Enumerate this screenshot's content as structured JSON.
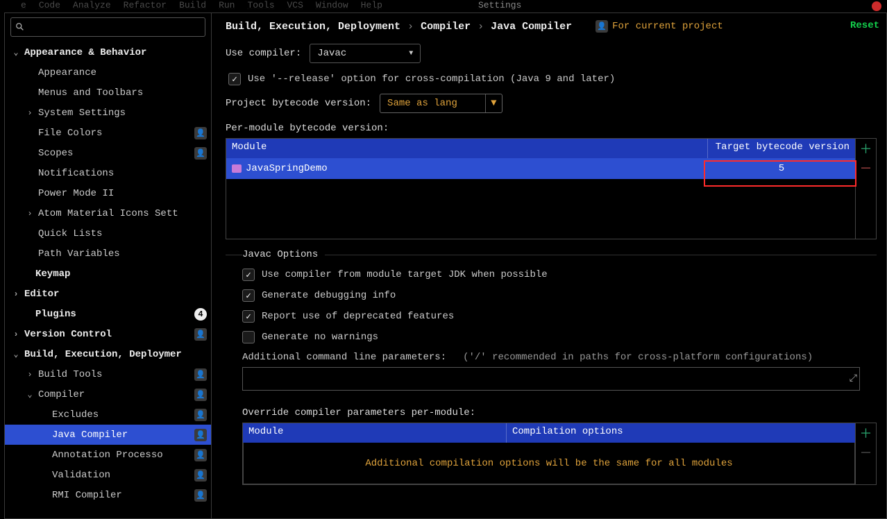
{
  "topmenu": [
    "e",
    "Code",
    "Analyze",
    "Refactor",
    "Build",
    "Run",
    "Tools",
    "VCS",
    "Window",
    "Help"
  ],
  "topmenu_tab": "Settings",
  "breadcrumb": {
    "a": "Build, Execution, Deployment",
    "b": "Compiler",
    "c": "Java Compiler",
    "for_project": "For current project",
    "reset": "Reset"
  },
  "use_compiler": {
    "label": "Use compiler:",
    "value": "Javac"
  },
  "release_option": {
    "label": "Use '--release' option for cross-compilation (Java 9 and later)",
    "checked": true
  },
  "project_bc": {
    "label": "Project bytecode version:",
    "value": "Same as lang"
  },
  "per_module_label": "Per-module bytecode version:",
  "per_module_headers": {
    "module": "Module",
    "target": "Target bytecode version"
  },
  "per_module_row": {
    "name": "JavaSpringDemo",
    "target": "5"
  },
  "javac_legend": "Javac Options",
  "javac_opts": {
    "o1": {
      "label": "Use compiler from module target JDK when possible",
      "checked": true
    },
    "o2": {
      "label": "Generate debugging info",
      "checked": true
    },
    "o3": {
      "label": "Report use of deprecated features",
      "checked": true
    },
    "o4": {
      "label": "Generate no warnings",
      "checked": false
    }
  },
  "addl_params": {
    "label": "Additional command line parameters:",
    "hint": "('/' recommended in paths for cross-platform configurations)"
  },
  "override": {
    "label": "Override compiler parameters per-module:",
    "h1": "Module",
    "h2": "Compilation options",
    "placeholder": "Additional compilation options will be the same for all modules"
  },
  "tree": [
    {
      "label": "Appearance & Behavior",
      "indent": 0,
      "bold": true,
      "arrow": "down"
    },
    {
      "label": "Appearance",
      "indent": 1
    },
    {
      "label": "Menus and Toolbars",
      "indent": 1
    },
    {
      "label": "System Settings",
      "indent": 1,
      "arrow": "right"
    },
    {
      "label": "File Colors",
      "indent": 1,
      "badge": "person"
    },
    {
      "label": "Scopes",
      "indent": 1,
      "badge": "person"
    },
    {
      "label": "Notifications",
      "indent": 1
    },
    {
      "label": "Power Mode II",
      "indent": 1
    },
    {
      "label": "Atom Material Icons Sett",
      "indent": 1,
      "arrow": "right"
    },
    {
      "label": "Quick Lists",
      "indent": 1
    },
    {
      "label": "Path Variables",
      "indent": 1
    },
    {
      "label": "Keymap",
      "indent": 0,
      "bold": true
    },
    {
      "label": "Editor",
      "indent": 0,
      "bold": true,
      "arrow": "right"
    },
    {
      "label": "Plugins",
      "indent": 0,
      "bold": true,
      "badge": "count",
      "count": "4"
    },
    {
      "label": "Version Control",
      "indent": 0,
      "bold": true,
      "arrow": "right",
      "badge": "person"
    },
    {
      "label": "Build, Execution, Deploymer",
      "indent": 0,
      "bold": true,
      "arrow": "down"
    },
    {
      "label": "Build Tools",
      "indent": 1,
      "arrow": "right",
      "badge": "person"
    },
    {
      "label": "Compiler",
      "indent": 1,
      "arrow": "down",
      "badge": "person"
    },
    {
      "label": "Excludes",
      "indent": 2,
      "badge": "person"
    },
    {
      "label": "Java Compiler",
      "indent": 2,
      "badge": "person",
      "selected": true
    },
    {
      "label": "Annotation Processo",
      "indent": 2,
      "badge": "person"
    },
    {
      "label": "Validation",
      "indent": 2,
      "badge": "person"
    },
    {
      "label": "RMI Compiler",
      "indent": 2,
      "badge": "person"
    }
  ]
}
